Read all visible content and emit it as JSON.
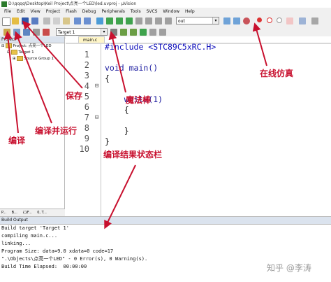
{
  "window": {
    "title": "D:\\qqqq\\Desktop\\Keil Project\\点亮一个LED\\led.uvproj - µVision"
  },
  "menu": [
    "File",
    "Edit",
    "View",
    "Project",
    "Flash",
    "Debug",
    "Peripherals",
    "Tools",
    "SVCS",
    "Window",
    "Help"
  ],
  "toolbar": {
    "search_value": "out",
    "target_value": "Target 1"
  },
  "project_panel": {
    "title": "Project",
    "tree": [
      {
        "label": "Project: 点亮一个LED"
      },
      {
        "label": "Target 1"
      },
      {
        "label": "Source Group 1"
      }
    ],
    "tabs": [
      "P...",
      "B...",
      "{}F...",
      "0, T..."
    ]
  },
  "editor": {
    "tab": "main.c",
    "lines": [
      {
        "n": "1",
        "text": "#include <STC89C5xRC.H>"
      },
      {
        "n": "2",
        "text": ""
      },
      {
        "n": "3",
        "text": "void main()"
      },
      {
        "n": "4",
        "text": "{"
      },
      {
        "n": "5",
        "text": ""
      },
      {
        "n": "6",
        "text": "    while(1)"
      },
      {
        "n": "7",
        "text": "    {"
      },
      {
        "n": "8",
        "text": ""
      },
      {
        "n": "9",
        "text": "    }"
      },
      {
        "n": "10",
        "text": "}"
      }
    ]
  },
  "build_output": {
    "title": "Build Output",
    "lines": [
      "Build target 'Target 1'",
      "compiling main.c...",
      "linking...",
      "Program Size: data=9.0 xdata=0 code=17",
      "\".\\Objects\\点亮一个LED\" - 0 Error(s), 0 Warning(s).",
      "Build Time Elapsed:  00:00:00"
    ]
  },
  "annotations": {
    "save": "保存",
    "wand": "魔法棒",
    "simulate": "在线仿真",
    "compile": "编译",
    "build_run": "编译并运行",
    "status_bar": "编译结果状态栏"
  },
  "watermark": "知乎 @李涛",
  "colors": {
    "annotation": "#c8102e"
  }
}
